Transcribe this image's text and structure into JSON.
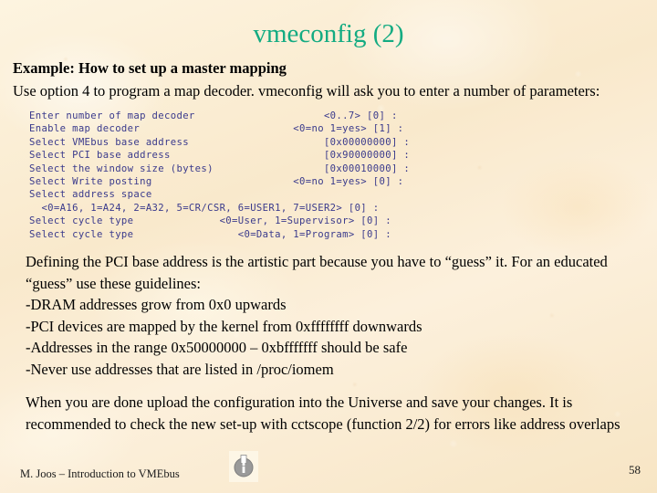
{
  "slide": {
    "title": "vmeconfig (2)",
    "title_color": "#13ab82",
    "background_color": "#fbeed2",
    "number": "58",
    "footer": "M. Joos – Introduction to VMEbus"
  },
  "content": {
    "lead_bold": "Example: How to set up a master mapping",
    "intro_paragraph": "Use option 4 to program a map decoder. vmeconfig will ask you to enter a number of parameters:",
    "code_block": {
      "text_color": "#3a3a8c",
      "lines": [
        "Enter number of map decoder                     <0..7> [0] :",
        "Enable map decoder                         <0=no 1=yes> [1] :",
        "Select VMEbus base address                      [0x00000000] :",
        "Select PCI base address                         [0x90000000] :",
        "Select the window size (bytes)                  [0x00010000] :",
        "Select Write posting                       <0=no 1=yes> [0] :",
        "Select address space",
        "  <0=A16, 1=A24, 2=A32, 5=CR/CSR, 6=USER1, 7=USER2> [0] :",
        "Select cycle type              <0=User, 1=Supervisor> [0] :",
        "Select cycle type                 <0=Data, 1=Program> [0] :"
      ]
    },
    "mid_paragraph": "Defining the PCI base address is the artistic part because you have to “guess” it. For an educated “guess” use these guidelines:",
    "guidelines": [
      "-DRAM addresses grow from 0x0 upwards",
      "-PCI devices are mapped by the kernel from 0xffffffff downwards",
      "-Addresses in the range 0x50000000 – 0xbfffffff should be safe",
      "-Never use addresses that are listed in /proc/iomem"
    ],
    "closing_paragraph": "When you are done upload the configuration into the Universe and save your changes. It is recommended to check the new set-up with cctscope (function 2/2) for errors like address overlaps"
  },
  "icons": {
    "info": "info-icon"
  }
}
